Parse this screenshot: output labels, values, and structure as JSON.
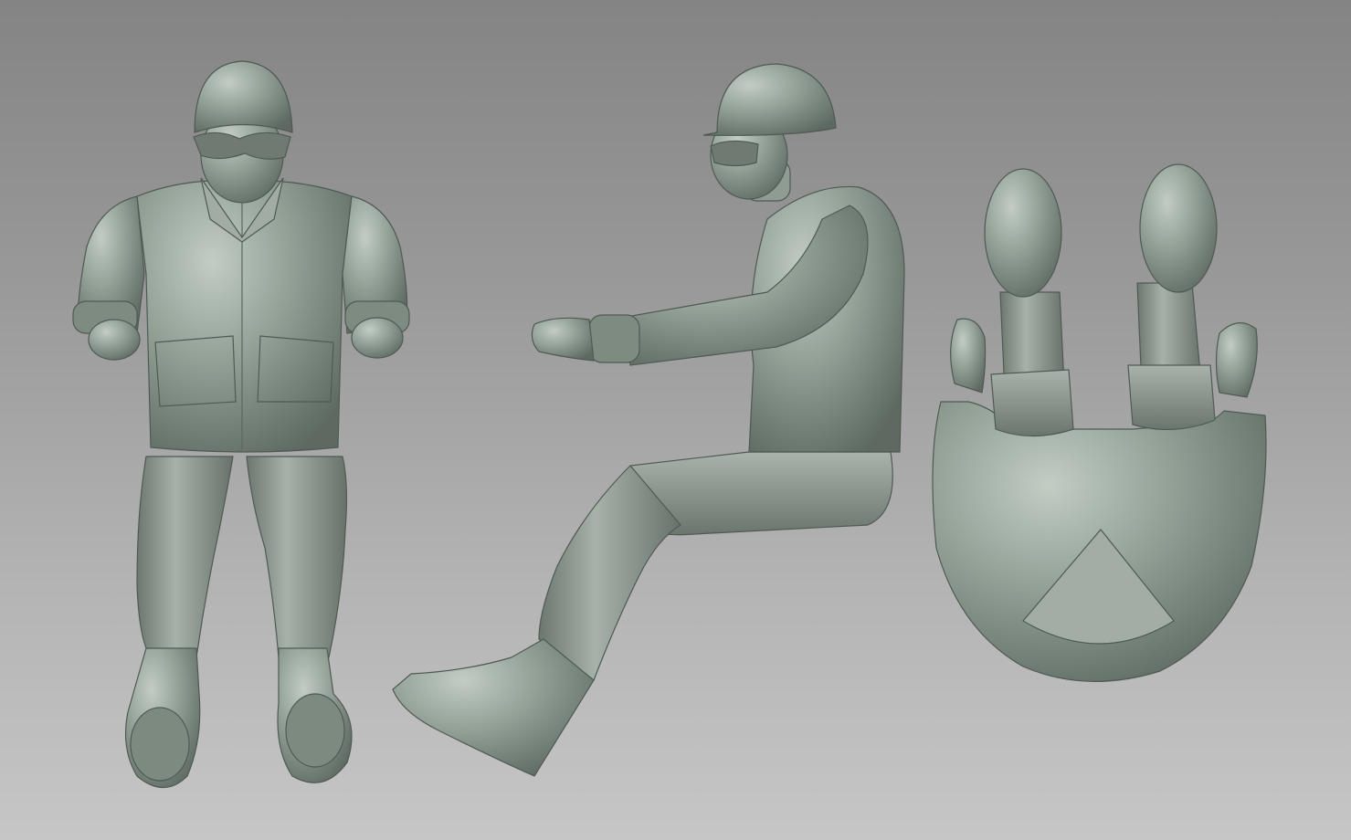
{
  "scene": {
    "description_label": "",
    "colors": {
      "background_top": "#848484",
      "background_bottom": "#c6c6c6",
      "clay": "#8c9a90",
      "clay_light": "#b7c3ba",
      "clay_dark": "#56625a"
    },
    "views": [
      "front-view",
      "side-view",
      "top-down-view"
    ]
  }
}
